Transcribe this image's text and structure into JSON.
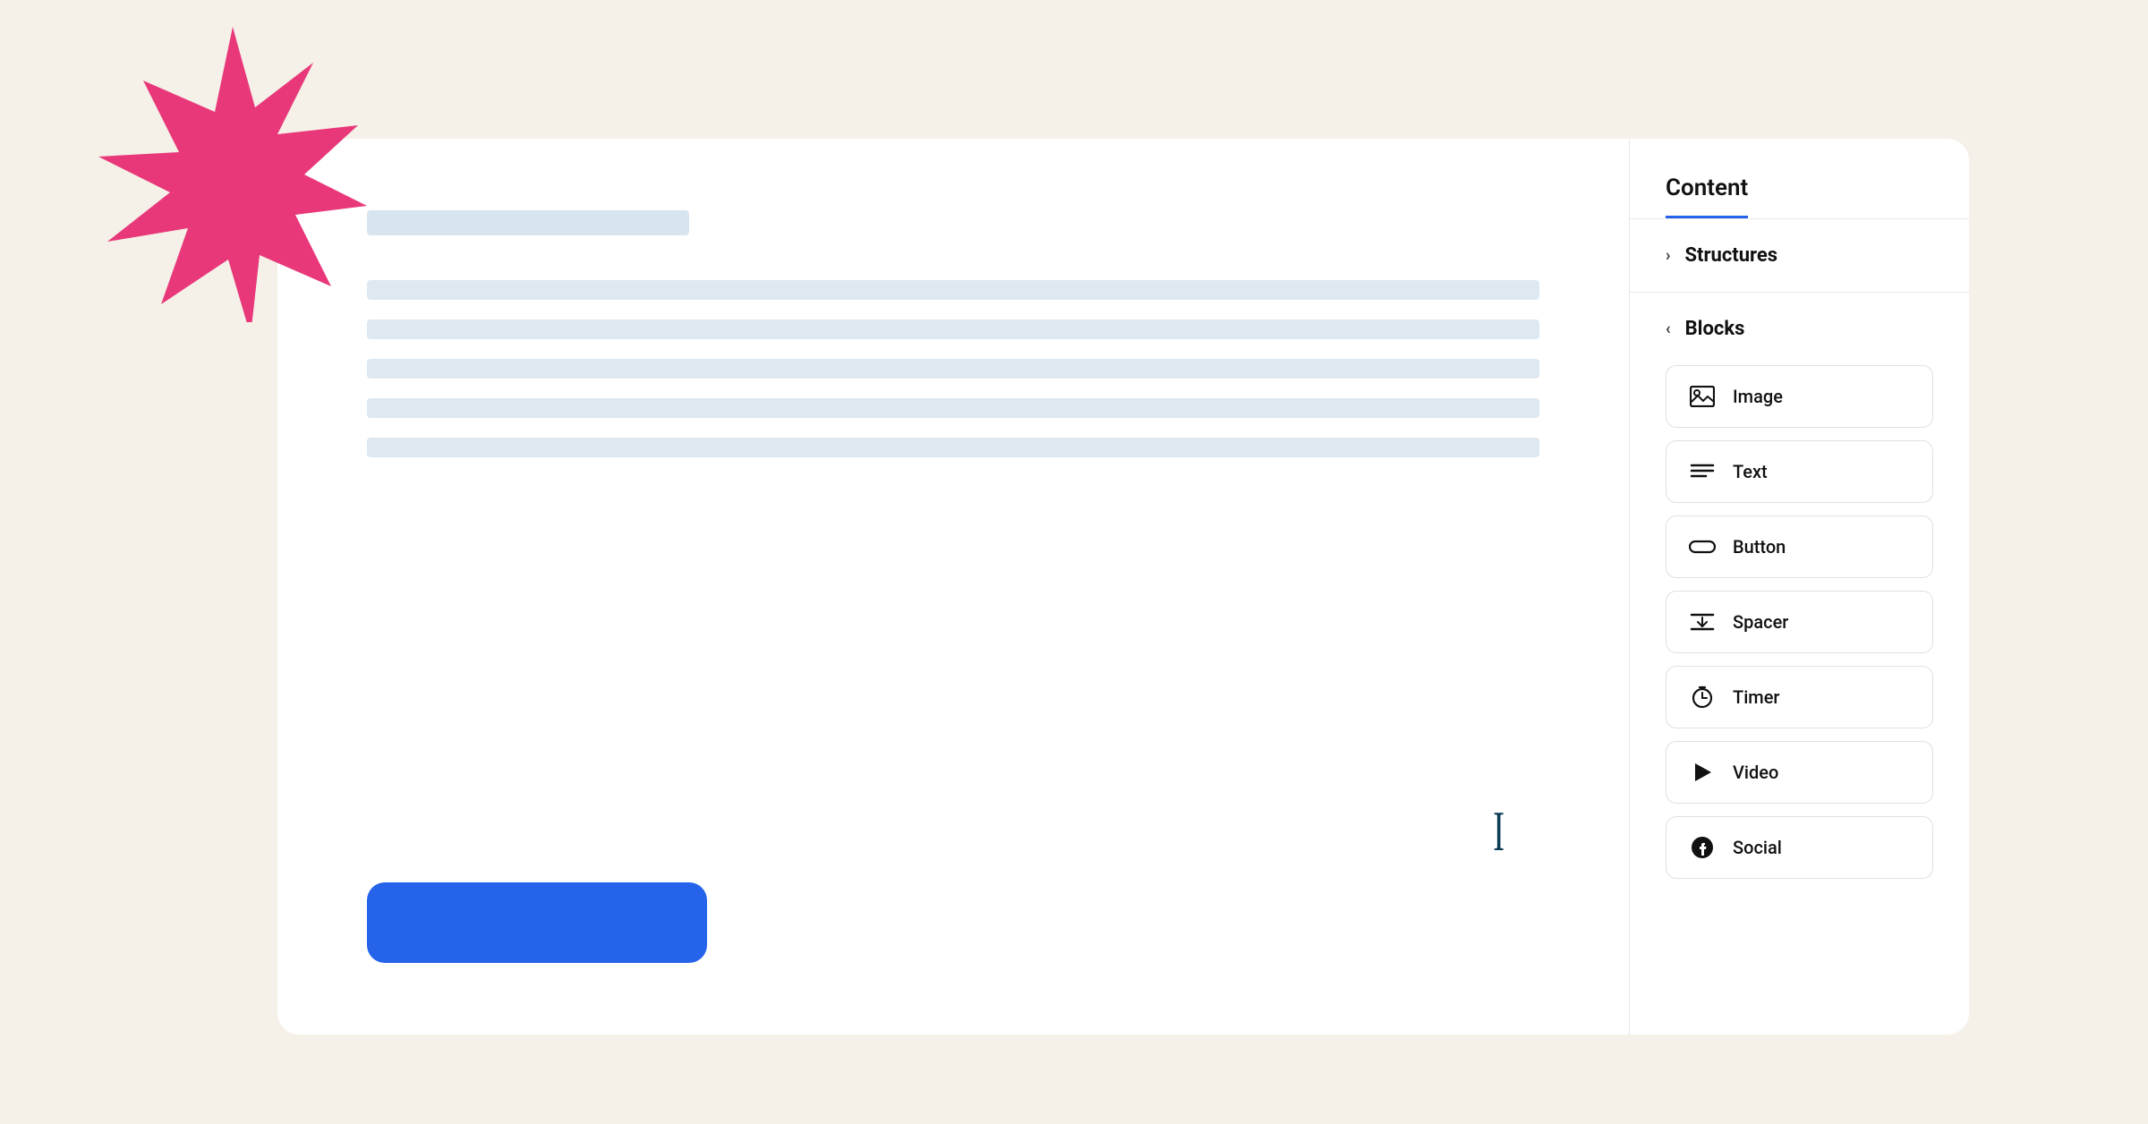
{
  "background_color": "#f5f0e8",
  "star": {
    "color": "#e8387a"
  },
  "right_panel": {
    "title": "Content",
    "structures_label": "Structures",
    "blocks_label": "Blocks",
    "blocks": [
      {
        "id": "image",
        "name": "Image",
        "icon": "image-icon"
      },
      {
        "id": "text",
        "name": "Text",
        "icon": "text-icon"
      },
      {
        "id": "button",
        "name": "Button",
        "icon": "button-icon"
      },
      {
        "id": "spacer",
        "name": "Spacer",
        "icon": "spacer-icon"
      },
      {
        "id": "timer",
        "name": "Timer",
        "icon": "timer-icon"
      },
      {
        "id": "video",
        "name": "Video",
        "icon": "video-icon"
      },
      {
        "id": "social",
        "name": "Social",
        "icon": "social-icon"
      }
    ]
  },
  "document": {
    "cursor_char": "I"
  }
}
